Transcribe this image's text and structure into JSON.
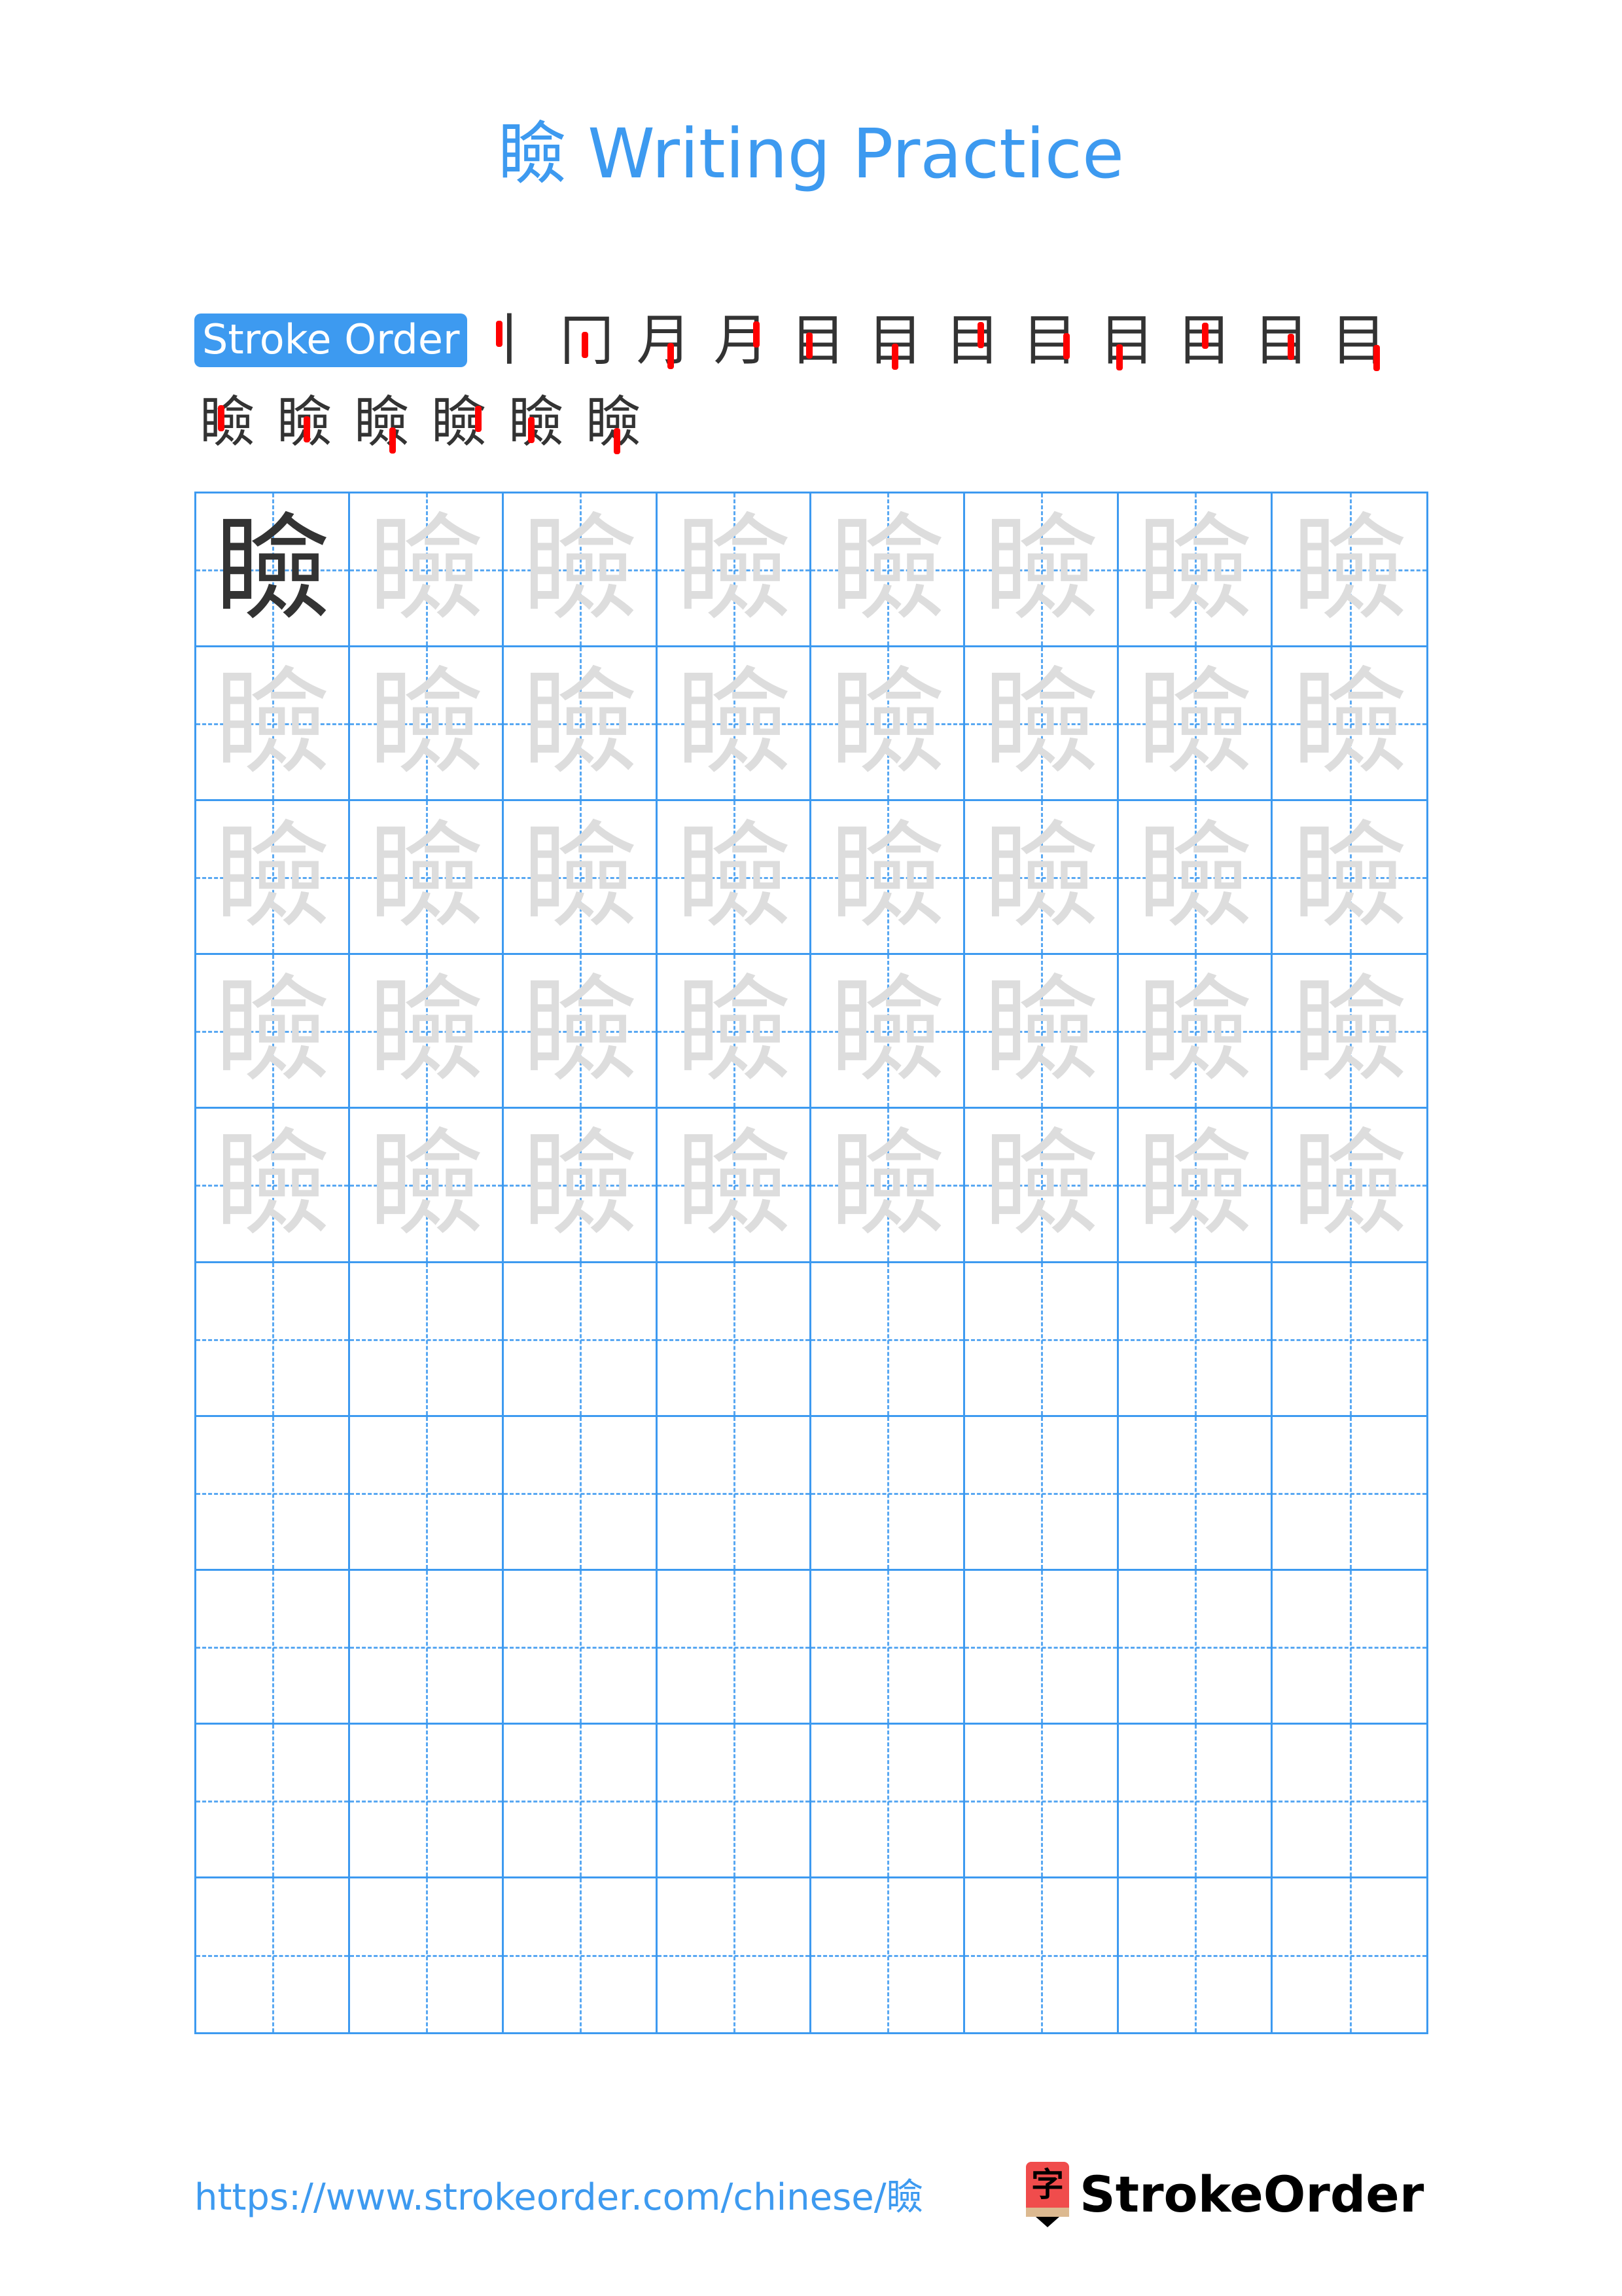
{
  "page": {
    "character": "瞼",
    "title": "瞼 Writing Practice",
    "accent_color": "#3d9af0",
    "trace_color": "#dddddd",
    "model_color": "#333333",
    "stroke_highlight_color": "#ff0000"
  },
  "stroke_order": {
    "label": "Stroke Order",
    "total_strokes": 18,
    "steps": [
      {
        "n": 1,
        "glyph": "丨"
      },
      {
        "n": 2,
        "glyph": "冂"
      },
      {
        "n": 3,
        "glyph": "月"
      },
      {
        "n": 4,
        "glyph": "月"
      },
      {
        "n": 5,
        "glyph": "目"
      },
      {
        "n": 6,
        "glyph": "目"
      },
      {
        "n": 7,
        "glyph": "目"
      },
      {
        "n": 8,
        "glyph": "目"
      },
      {
        "n": 9,
        "glyph": "目"
      },
      {
        "n": 10,
        "glyph": "目"
      },
      {
        "n": 11,
        "glyph": "目"
      },
      {
        "n": 12,
        "glyph": "目"
      },
      {
        "n": 13,
        "glyph": "瞼"
      },
      {
        "n": 14,
        "glyph": "瞼"
      },
      {
        "n": 15,
        "glyph": "瞼"
      },
      {
        "n": 16,
        "glyph": "瞼"
      },
      {
        "n": 17,
        "glyph": "瞼"
      },
      {
        "n": 18,
        "glyph": "瞼"
      }
    ]
  },
  "practice_grid": {
    "columns": 8,
    "rows": 10,
    "model_cells": 1,
    "trace_rows": 5,
    "blank_rows": 5
  },
  "footer": {
    "url": "https://www.strokeorder.com/chinese/瞼",
    "logo_glyph": "字",
    "brand": "StrokeOrder"
  }
}
